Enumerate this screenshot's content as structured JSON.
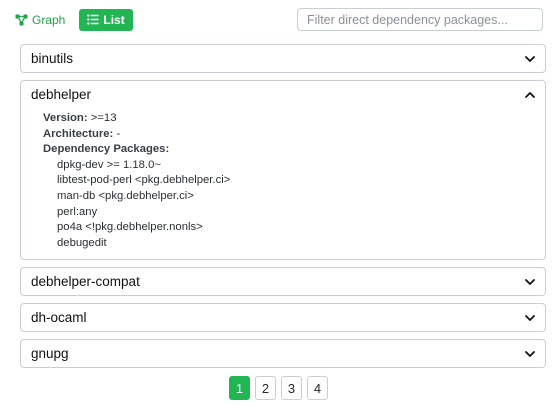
{
  "toolbar": {
    "graph_label": "Graph",
    "list_label": "List",
    "filter_placeholder": "Filter direct dependency packages...",
    "filter_value": ""
  },
  "packages": [
    {
      "name": "binutils",
      "expanded": false
    },
    {
      "name": "debhelper",
      "expanded": true,
      "version_label": "Version:",
      "version": ">=13",
      "arch_label": "Architecture:",
      "arch": "-",
      "deps_label": "Dependency Packages:",
      "deps": [
        "dpkg-dev >= 1.18.0~",
        "libtest-pod-perl <pkg.debhelper.ci>",
        "man-db <pkg.debhelper.ci>",
        "perl:any",
        "po4a <!pkg.debhelper.nonls>",
        "debugedit"
      ]
    },
    {
      "name": "debhelper-compat",
      "expanded": false
    },
    {
      "name": "dh-ocaml",
      "expanded": false
    },
    {
      "name": "gnupg",
      "expanded": false
    }
  ],
  "pagination": {
    "pages": [
      "1",
      "2",
      "3",
      "4"
    ],
    "current": "1"
  },
  "colors": {
    "accent": "#22b554",
    "border": "#c9ced4"
  },
  "icons": {
    "graph": "graph-icon",
    "list": "list-icon",
    "collapsed": "chevron-down-icon",
    "expanded": "chevron-up-icon"
  }
}
